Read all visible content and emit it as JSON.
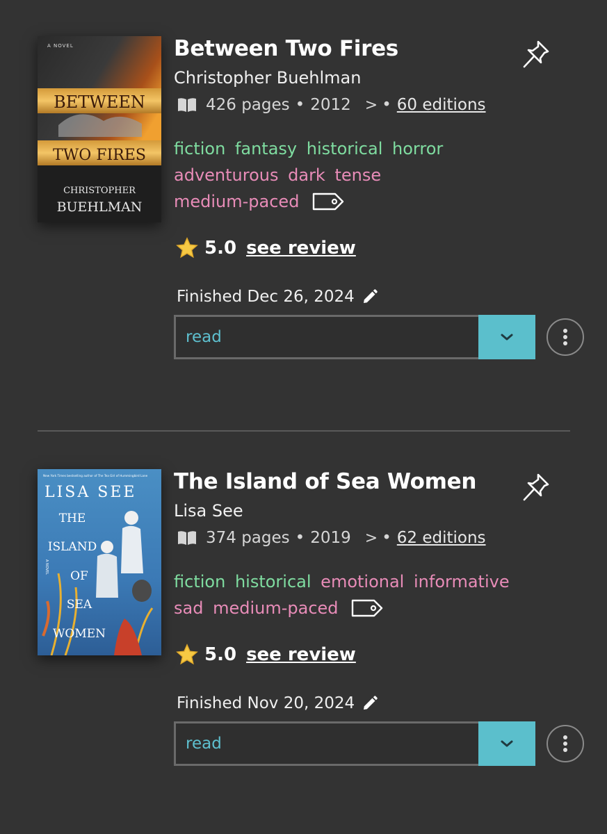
{
  "colors": {
    "background": "#333333",
    "genre_tag": "#7fdca0",
    "mood_tag": "#e88cb8",
    "status_accent": "#5bbfcc"
  },
  "books": [
    {
      "title": "Between Two Fires",
      "author": "Christopher Buehlman",
      "pages": "426 pages",
      "year": "2012",
      "editions": "60 editions",
      "genre_tags": [
        "fiction",
        "fantasy",
        "historical",
        "horror"
      ],
      "mood_tags": [
        "adventurous",
        "dark",
        "tense",
        "medium-paced"
      ],
      "rating": "5.0",
      "see_review": "see review",
      "finished": "Finished Dec 26, 2024",
      "status": "read",
      "cover": {
        "top_text": "A NOVEL",
        "title_line1": "BETWEEN",
        "title_line2": "TWO FIRES",
        "author_line1": "CHRISTOPHER",
        "author_line2": "BUEHLMAN"
      }
    },
    {
      "title": "The Island of Sea Women",
      "author": "Lisa See",
      "pages": "374 pages",
      "year": "2019",
      "editions": "62 editions",
      "genre_tags": [
        "fiction",
        "historical"
      ],
      "mood_tags": [
        "emotional",
        "informative",
        "sad",
        "medium-paced"
      ],
      "rating": "5.0",
      "see_review": "see review",
      "finished": "Finished Nov 20, 2024",
      "status": "read",
      "cover": {
        "top_text": "New York Times bestselling author of The Tea Girl of Hummingbird Lane",
        "author": "LISA SEE",
        "title_lines": [
          "THE",
          "ISLAND",
          "OF",
          "SEA",
          "WOMEN"
        ],
        "side_text": "A NOVEL"
      }
    }
  ]
}
